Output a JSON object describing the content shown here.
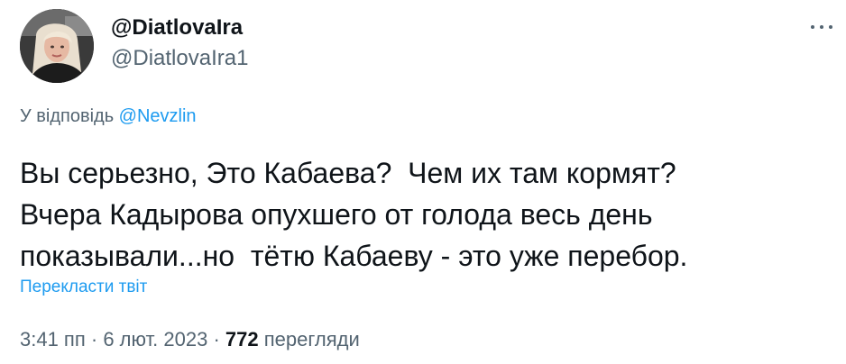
{
  "author": {
    "display_name": "@DiatlovaIra",
    "handle": "@DiatlovaIra1"
  },
  "reply": {
    "prefix": "У відповідь ",
    "mention": "@Nevzlin"
  },
  "tweet": {
    "lines": [
      "Вы серьезно, Это Кабаева?  Чем их там кормят?",
      "Вчера Кадырова опухшего от голода весь день",
      "показывали...но  тётю Кабаеву - это уже перебор."
    ]
  },
  "translate_label": "Перекласти твіт",
  "meta": {
    "time": "3:41 пп",
    "separator": " · ",
    "date": "6 лют. 2023",
    "views_count": "772",
    "views_label": " перегляди"
  },
  "icons": {
    "more": "more-options-icon",
    "avatar": "avatar-image"
  },
  "colors": {
    "text": "#0f1419",
    "secondary": "#536471",
    "link": "#1d9bf0"
  }
}
